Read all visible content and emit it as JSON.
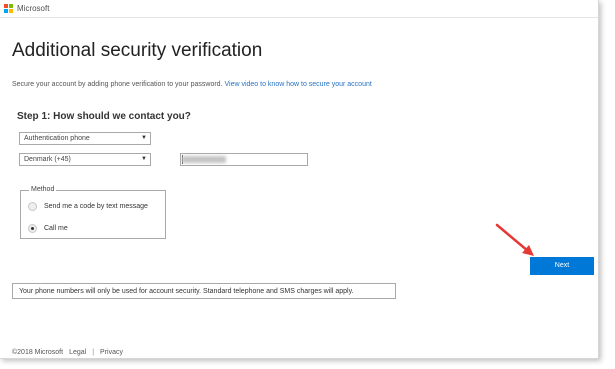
{
  "header": {
    "brand": "Microsoft",
    "logo_colors": [
      "#f25022",
      "#7fba00",
      "#00a4ef",
      "#ffb900"
    ]
  },
  "page": {
    "title": "Additional security verification",
    "subtitle": "Secure your account by adding phone verification to your password.",
    "video_link": "View video to know how to secure your account"
  },
  "step1": {
    "heading": "Step 1: How should we contact you?",
    "contact_method": "Authentication phone",
    "country": "Denmark (+45)",
    "dropdown_arrow": "▼"
  },
  "method": {
    "legend": "Method",
    "options": [
      {
        "label": "Send me a code by text message",
        "selected": false
      },
      {
        "label": "Call me",
        "selected": true
      }
    ]
  },
  "actions": {
    "next_label": "Next",
    "accent_color": "#0078d7",
    "annotation_arrow_color": "#e53935"
  },
  "notice": {
    "text": "Your phone numbers will only be used for account security. Standard telephone and SMS charges will apply."
  },
  "footer": {
    "copyright": "©2018 Microsoft",
    "legal": "Legal",
    "separator": "|",
    "privacy": "Privacy"
  }
}
